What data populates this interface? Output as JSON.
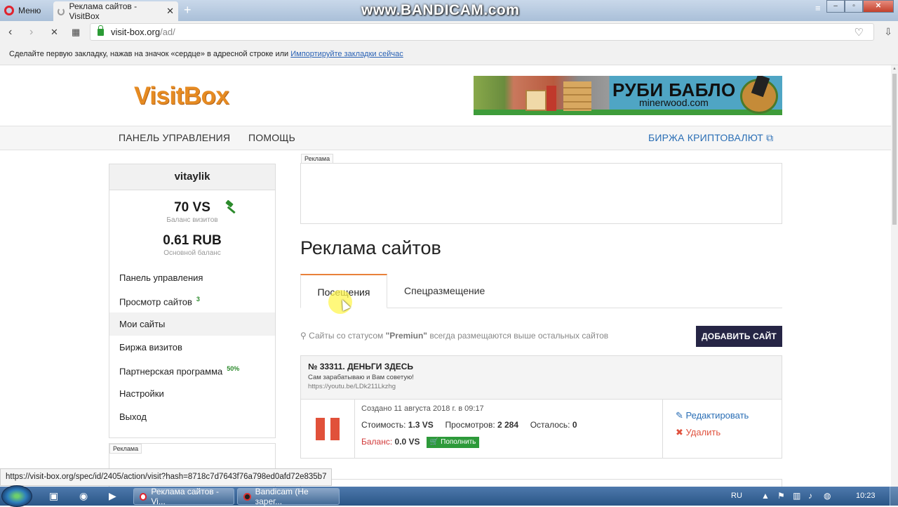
{
  "browser": {
    "menu_label": "Меню",
    "tab_title": "Реклама сайтов - VisitBox",
    "tab_close": "✕",
    "new_tab": "+",
    "watermark": "www.BANDICAM.com",
    "url_host": "visit-box.org",
    "url_path": "/ad/",
    "bookmark_hint": "Сделайте первую закладку, нажав на значок «сердце» в адресной строке или",
    "bookmark_link": "Импортируйте закладки сейчас",
    "status_url": "https://visit-box.org/spec/id/2405/action/visit?hash=8718c7d7643f76a798ed0afd72e835b7"
  },
  "site": {
    "logo": "VisitBox",
    "banner": {
      "title": "РУБИ БАБЛО",
      "domain": "minerwood.com"
    },
    "nav": {
      "dashboard": "ПАНЕЛЬ УПРАВЛЕНИЯ",
      "help": "ПОМОЩЬ",
      "crypto": "БИРЖА КРИПТОВАЛЮТ"
    }
  },
  "sidebar": {
    "username": "vitaylik",
    "visits_balance": "70 VS",
    "visits_balance_label": "Баланс визитов",
    "main_balance": "0.61 RUB",
    "main_balance_label": "Основной баланс",
    "items": [
      {
        "label": "Панель управления",
        "badge": ""
      },
      {
        "label": "Просмотр сайтов",
        "badge": "3"
      },
      {
        "label": "Мои сайты",
        "badge": ""
      },
      {
        "label": "Биржа визитов",
        "badge": ""
      },
      {
        "label": "Партнерская программа",
        "badge": "50%"
      },
      {
        "label": "Настройки",
        "badge": ""
      },
      {
        "label": "Выход",
        "badge": ""
      }
    ],
    "ad_label": "Реклама"
  },
  "main": {
    "ad_label": "Реклама",
    "title": "Реклама сайтов",
    "tabs": [
      {
        "label": "Посещения"
      },
      {
        "label": "Спецразмещение"
      }
    ],
    "hint_prefix": "Сайты со статусом",
    "hint_status": "\"Premiun\"",
    "hint_suffix": "всегда размещаются выше остальных сайтов",
    "add_button": "ДОБАВИТЬ САЙТ",
    "site": {
      "title": "№ 33311. ДЕНЬГИ ЗДЕСЬ",
      "description": "Сам зарабатываю и Вам советую!",
      "link": "https://youtu.be/LDk211Lkzhg",
      "created": "Создано 11 августа 2018 г. в 09:17",
      "cost_label": "Стоимость:",
      "cost_value": "1.3 VS",
      "views_label": "Просмотров:",
      "views_value": "2 284",
      "left_label": "Осталось:",
      "left_value": "0",
      "balance_label": "Баланс:",
      "balance_value": "0.0 VS",
      "topup_button": "Пополнить",
      "edit_link": "Редактировать",
      "delete_link": "Удалить"
    }
  },
  "taskbar": {
    "items": [
      {
        "label": "Реклама сайтов - Vi..."
      },
      {
        "label": "Bandicam (Не зарег..."
      }
    ],
    "lang": "RU",
    "clock": "10:23"
  },
  "colors": {
    "accent_orange": "#e68b22",
    "button_dark": "#262545",
    "link_blue": "#2a6eb5",
    "pause_red": "#e1513a",
    "topup_green": "#2d9a3a"
  }
}
